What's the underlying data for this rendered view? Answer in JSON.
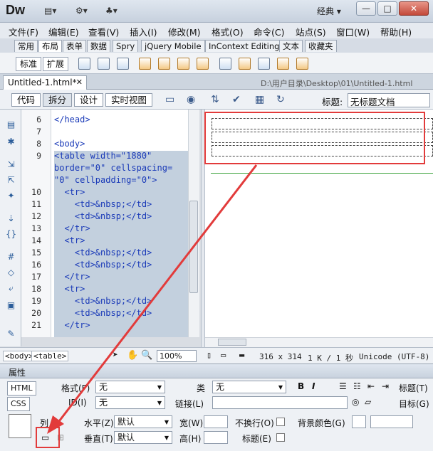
{
  "app": {
    "logo": "Dw",
    "workspace": "经典 ▾"
  },
  "window_buttons": {
    "minimize": "—",
    "maximize": "□",
    "close": "✕"
  },
  "menu": [
    "文件(F)",
    "编辑(E)",
    "查看(V)",
    "插入(I)",
    "修改(M)",
    "格式(O)",
    "命令(C)",
    "站点(S)",
    "窗口(W)",
    "帮助(H)"
  ],
  "insert_tabs": [
    "常用",
    "布局",
    "表单",
    "数据",
    "Spry",
    "jQuery Mobile",
    "InContext Editing",
    "文本",
    "收藏夹"
  ],
  "insert_bar": {
    "standard": "标准",
    "expanded": "扩展"
  },
  "document": {
    "tab": "Untitled-1.html*",
    "path": "D:\\用户目录\\Desktop\\01\\Untitled-1.html"
  },
  "views": {
    "code": "代码",
    "split": "拆分",
    "design": "设计",
    "live": "实时视图"
  },
  "title_field": {
    "label": "标题:",
    "value": "无标题文档"
  },
  "code": {
    "line_numbers": [
      "6",
      "7",
      "8",
      "9",
      "",
      "",
      "10",
      "11",
      "12",
      "13",
      "14",
      "15",
      "16",
      "17",
      "18",
      "19",
      "20",
      "21"
    ],
    "lines": [
      "</head>",
      "",
      "<body>",
      "<table width=\"1880\"",
      "border=\"0\" cellspacing=",
      "\"0\" cellpadding=\"0\">",
      "  <tr>",
      "    <td>&nbsp;</td>",
      "    <td>&nbsp;</td>",
      "  </tr>",
      "  <tr>",
      "    <td>&nbsp;</td>",
      "    <td>&nbsp;</td>",
      "  </tr>",
      "  <tr>",
      "    <td>&nbsp;</td>",
      "    <td>&nbsp;</td>",
      "  </tr>"
    ]
  },
  "status": {
    "tags": [
      "<body>",
      "<table>"
    ],
    "zoom": "100%",
    "size": "316 x 314",
    "info": "1 K / 1 秒",
    "encoding": "Unicode (UTF-8)"
  },
  "properties": {
    "header": "属性",
    "html_btn": "HTML",
    "css_btn": "CSS",
    "format_label": "格式(F)",
    "format_value": "无",
    "class_label": "类",
    "class_value": "无",
    "id_label": "ID(I)",
    "id_value": "无",
    "link_label": "链接(L)",
    "bold": "B",
    "italic": "I",
    "title_label": "标题(T)",
    "target_label": "目标(G)",
    "col_label": "列",
    "horz_label": "水平(Z)",
    "horz_value": "默认",
    "vert_label": "垂直(T)",
    "vert_value": "默认",
    "width_label": "宽(W)",
    "height_label": "高(H)",
    "nowrap_label": "不换行(O)",
    "header_label": "标题(E)",
    "bg_label": "背景颜色(G)"
  }
}
